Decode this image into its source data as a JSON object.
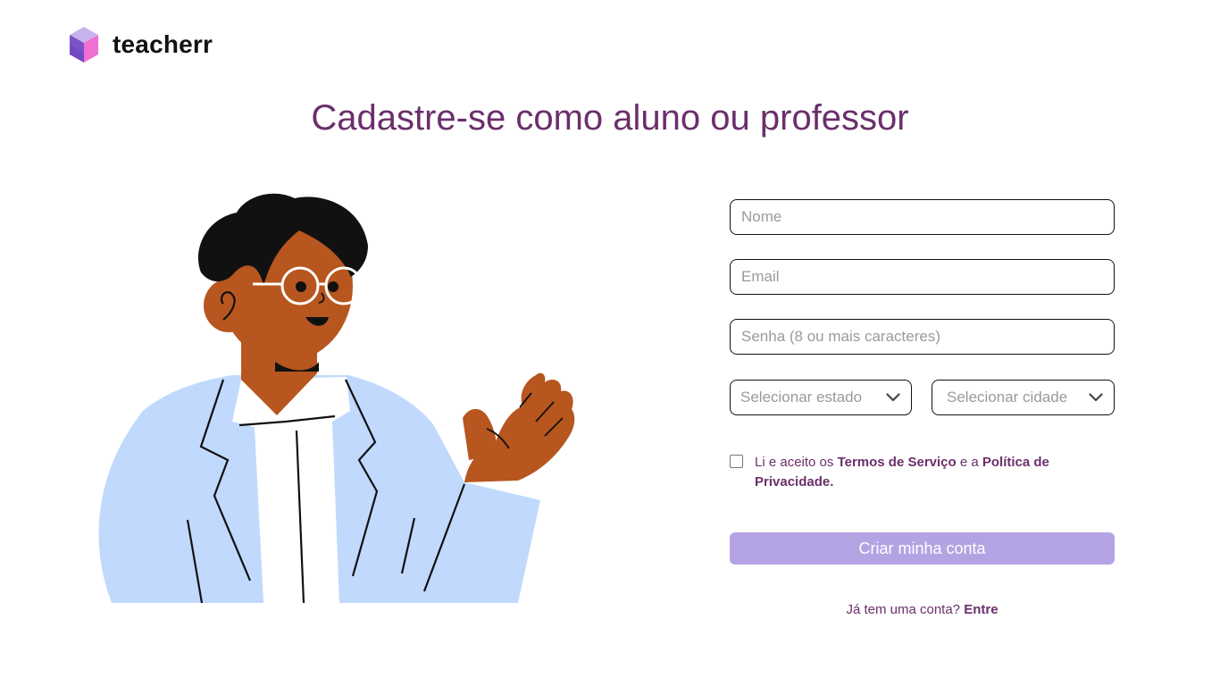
{
  "brand": {
    "name": "teacherr",
    "logo_icon": "cube-icon",
    "colors": {
      "top": "#c7b3ec",
      "left": "#7b53c9",
      "right": "#f06fd2"
    }
  },
  "title": "Cadastre-se como aluno ou professor",
  "form": {
    "name_placeholder": "Nome",
    "email_placeholder": "Email",
    "password_placeholder": "Senha (8 ou mais caracteres)",
    "state_select": {
      "label": "Selecionar estado",
      "icon": "chevron-down-icon"
    },
    "city_select": {
      "label": "Selecionar cidade",
      "icon": "chevron-down-icon"
    },
    "terms": {
      "prefix": "Li e aceito os ",
      "terms_link": "Termos de Serviço",
      "middle": " e a ",
      "privacy_link": "Política de Privacidade.",
      "checked": false
    },
    "submit_label": "Criar minha conta",
    "login_prompt": "Já tem uma conta? ",
    "login_link": "Entre"
  },
  "colors": {
    "primary_text": "#6b2f6b",
    "button_bg": "#b4a3e3",
    "jacket": "#c0d9fd",
    "skin": "#b7561e"
  }
}
